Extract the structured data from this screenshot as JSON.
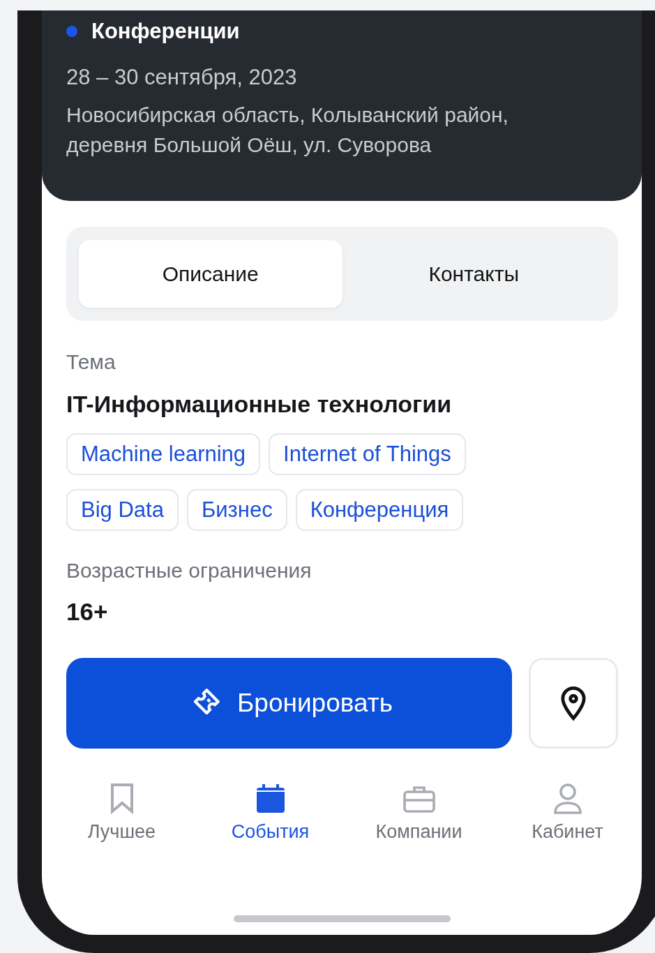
{
  "header": {
    "category": "Конференции",
    "date": "28 – 30 сентября, 2023",
    "address": "Новосибирская область, Колыванский район, деревня Большой Оёш, ул. Суворова"
  },
  "tabs": [
    {
      "label": "Описание",
      "selected": true
    },
    {
      "label": "Контакты",
      "selected": false
    }
  ],
  "topic": {
    "label": "Тема",
    "value": "IT-Информационные технологии"
  },
  "tags": [
    [
      "Machine learning",
      "Internet of Things"
    ],
    [
      "Big Data",
      "Бизнес",
      "Конференция"
    ]
  ],
  "age": {
    "label": "Возрастные ограничения",
    "value": "16+"
  },
  "book_button": {
    "label": "Бронировать"
  },
  "nav": [
    {
      "label": "Лучшее",
      "kind": "bookmark",
      "selected": false
    },
    {
      "label": "События",
      "kind": "calendar",
      "selected": true
    },
    {
      "label": "Компании",
      "kind": "briefcase",
      "selected": false
    },
    {
      "label": "Кабинет",
      "kind": "person",
      "selected": false
    }
  ]
}
